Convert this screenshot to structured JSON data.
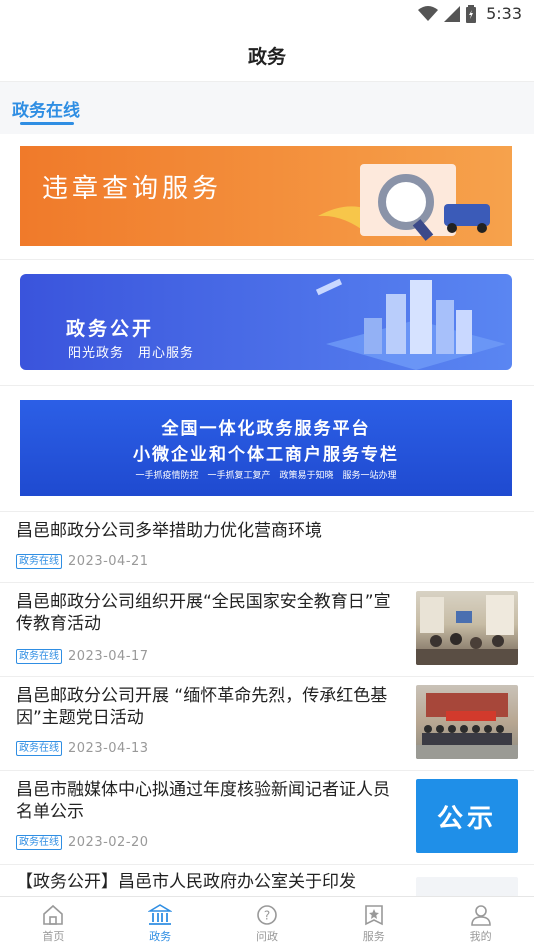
{
  "status": {
    "time": "5:33"
  },
  "header": {
    "title": "政务"
  },
  "section": {
    "tab_label": "政务在线"
  },
  "banners": [
    {
      "title": "违章查询服务"
    },
    {
      "title": "政务公开",
      "subtitle": "阳光政务　用心服务"
    },
    {
      "line1": "全国一体化政务服务平台",
      "line2": "小微企业和个体工商户服务专栏",
      "line3": "一手抓疫情防控　一手抓复工复产　政策易于知晓　服务一站办理"
    }
  ],
  "news": [
    {
      "title": "昌邑邮政分公司多举措助力优化营商环境",
      "tag": "政务在线",
      "date": "2023-04-21"
    },
    {
      "title": "昌邑邮政分公司组织开展“全民国家安全教育日”宣传教育活动",
      "tag": "政务在线",
      "date": "2023-04-17"
    },
    {
      "title": "昌邑邮政分公司开展 “缅怀革命先烈，传承红色基因”主题党日活动",
      "tag": "政务在线",
      "date": "2023-04-13"
    },
    {
      "title": "昌邑市融媒体中心拟通过年度核验新闻记者证人员名单公示",
      "tag": "政务在线",
      "date": "2023-02-20",
      "thumb_text": "公示"
    },
    {
      "title": "【政务公开】昌邑市人民政府办公室关于印发"
    }
  ],
  "tabbar": [
    {
      "label": "首页",
      "icon": "home-icon"
    },
    {
      "label": "政务",
      "icon": "government-building-icon"
    },
    {
      "label": "问政",
      "icon": "question-icon"
    },
    {
      "label": "服务",
      "icon": "service-star-icon"
    },
    {
      "label": "我的",
      "icon": "person-icon"
    }
  ],
  "colors": {
    "accent": "#2f8ee3",
    "orange_banner": "#f08a3a",
    "blue_banner": "#3a5fe0"
  }
}
